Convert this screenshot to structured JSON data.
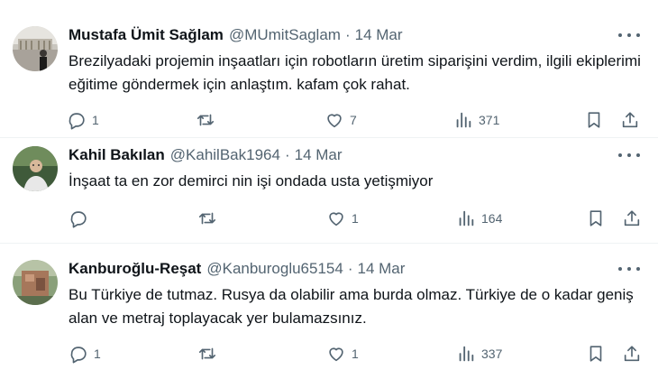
{
  "tweets": [
    {
      "author": "Mustafa Ümit Sağlam",
      "handle": "@MUmitSaglam",
      "separator": "·",
      "time": "14 Mar",
      "text": "Brezilyadaki projemin inşaatları için robotların üretim siparişini verdim, ilgili ekiplerimi eğitime göndermek için anlaştım. kafam çok rahat.",
      "replies": "1",
      "retweets": "",
      "likes": "7",
      "views": "371"
    },
    {
      "author": "Kahil Bakılan",
      "handle": "@KahilBak1964",
      "separator": "·",
      "time": "14 Mar",
      "text": "İnşaat ta en zor demirci nin işi ondada usta yetişmiyor",
      "replies": "",
      "retweets": "",
      "likes": "1",
      "views": "164"
    },
    {
      "author": "Kanburoğlu-Reşat",
      "handle": "@Kanburoglu65154",
      "separator": "·",
      "time": "14 Mar",
      "text": "Bu Türkiye de tutmaz. Rusya da olabilir ama burda olmaz. Türkiye de o kadar geniş alan ve metraj toplayacak yer bulamazsınız.",
      "replies": "1",
      "retweets": "",
      "likes": "1",
      "views": "337"
    }
  ],
  "icons": {
    "reply": "reply-icon",
    "retweet": "retweet-icon",
    "like": "heart-icon",
    "views": "views-chart-icon",
    "bookmark": "bookmark-icon",
    "share": "share-icon",
    "more": "more-options-icon"
  },
  "colors": {
    "text": "#0f1419",
    "secondary": "#536471",
    "divider": "#eff3f4"
  }
}
